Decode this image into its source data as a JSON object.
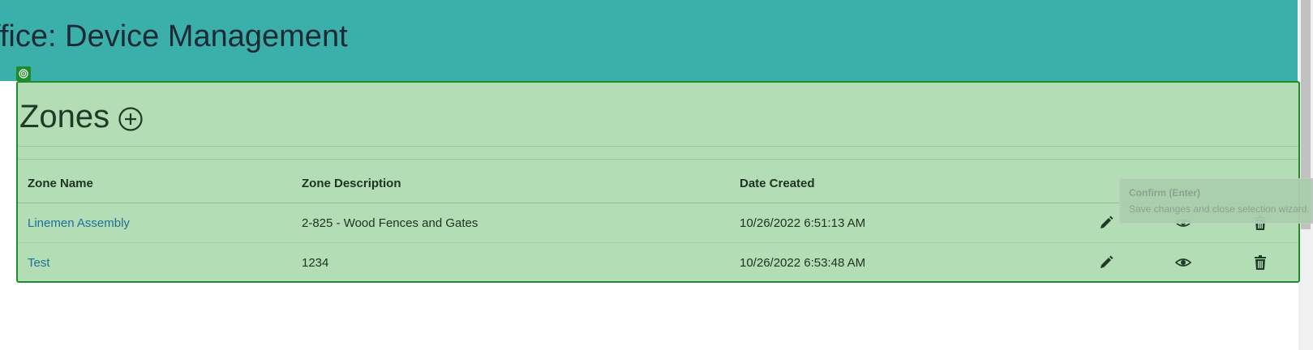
{
  "header": {
    "title": "ffice: Device Management"
  },
  "zones": {
    "title": "Zones",
    "columns": [
      "Zone Name",
      "Zone Description",
      "Date Created"
    ],
    "rows": [
      {
        "name": "Linemen Assembly",
        "description": "2-825 - Wood Fences and Gates",
        "created": "10/26/2022 6:51:13 AM"
      },
      {
        "name": "Test",
        "description": "1234",
        "created": "10/26/2022 6:53:48 AM"
      }
    ]
  },
  "tooltip": {
    "title": "Confirm (Enter)",
    "body": "Save changes and close selection wizard."
  },
  "colors": {
    "header_bg": "#3bb0aa",
    "panel_bg": "#b3ddb4",
    "selection_border": "#1e8c2a",
    "link": "#1f6f99"
  },
  "icons": [
    "target-icon",
    "add-circle-icon",
    "pencil-icon",
    "eye-icon",
    "trash-icon"
  ]
}
